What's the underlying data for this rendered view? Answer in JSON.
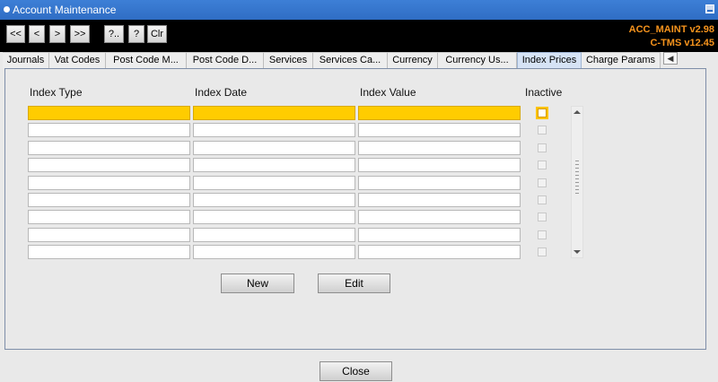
{
  "window": {
    "title": "Account Maintenance"
  },
  "toolbar": {
    "buttons": [
      "<<",
      "<",
      ">",
      ">>",
      "?..",
      "?",
      "Clr"
    ],
    "version_1": "ACC_MAINT v2.98",
    "version_2": "C-TMS v12.45"
  },
  "tabs": [
    {
      "label": "Journals"
    },
    {
      "label": "Vat Codes"
    },
    {
      "label": "Post Code M..."
    },
    {
      "label": "Post Code D..."
    },
    {
      "label": "Services"
    },
    {
      "label": "Services Ca..."
    },
    {
      "label": "Currency"
    },
    {
      "label": "Currency Us..."
    },
    {
      "label": "Index Prices",
      "active": true
    },
    {
      "label": "Charge Params"
    }
  ],
  "grid": {
    "headers": {
      "index_type": "Index Type",
      "index_date": "Index Date",
      "index_value": "Index Value",
      "inactive": "Inactive"
    },
    "rows": [
      {
        "index_type": "",
        "index_date": "",
        "index_value": "",
        "inactive": false,
        "selected": true
      },
      {
        "index_type": "",
        "index_date": "",
        "index_value": "",
        "inactive": false
      },
      {
        "index_type": "",
        "index_date": "",
        "index_value": "",
        "inactive": false
      },
      {
        "index_type": "",
        "index_date": "",
        "index_value": "",
        "inactive": false
      },
      {
        "index_type": "",
        "index_date": "",
        "index_value": "",
        "inactive": false
      },
      {
        "index_type": "",
        "index_date": "",
        "index_value": "",
        "inactive": false
      },
      {
        "index_type": "",
        "index_date": "",
        "index_value": "",
        "inactive": false
      },
      {
        "index_type": "",
        "index_date": "",
        "index_value": "",
        "inactive": false
      },
      {
        "index_type": "",
        "index_date": "",
        "index_value": "",
        "inactive": false
      }
    ]
  },
  "actions": {
    "new_label": "New",
    "edit_label": "Edit",
    "close_label": "Close"
  },
  "colors": {
    "title_bar": "#2f6dc4",
    "selected_row": "#ffcc00",
    "version_text": "#f7941d"
  }
}
